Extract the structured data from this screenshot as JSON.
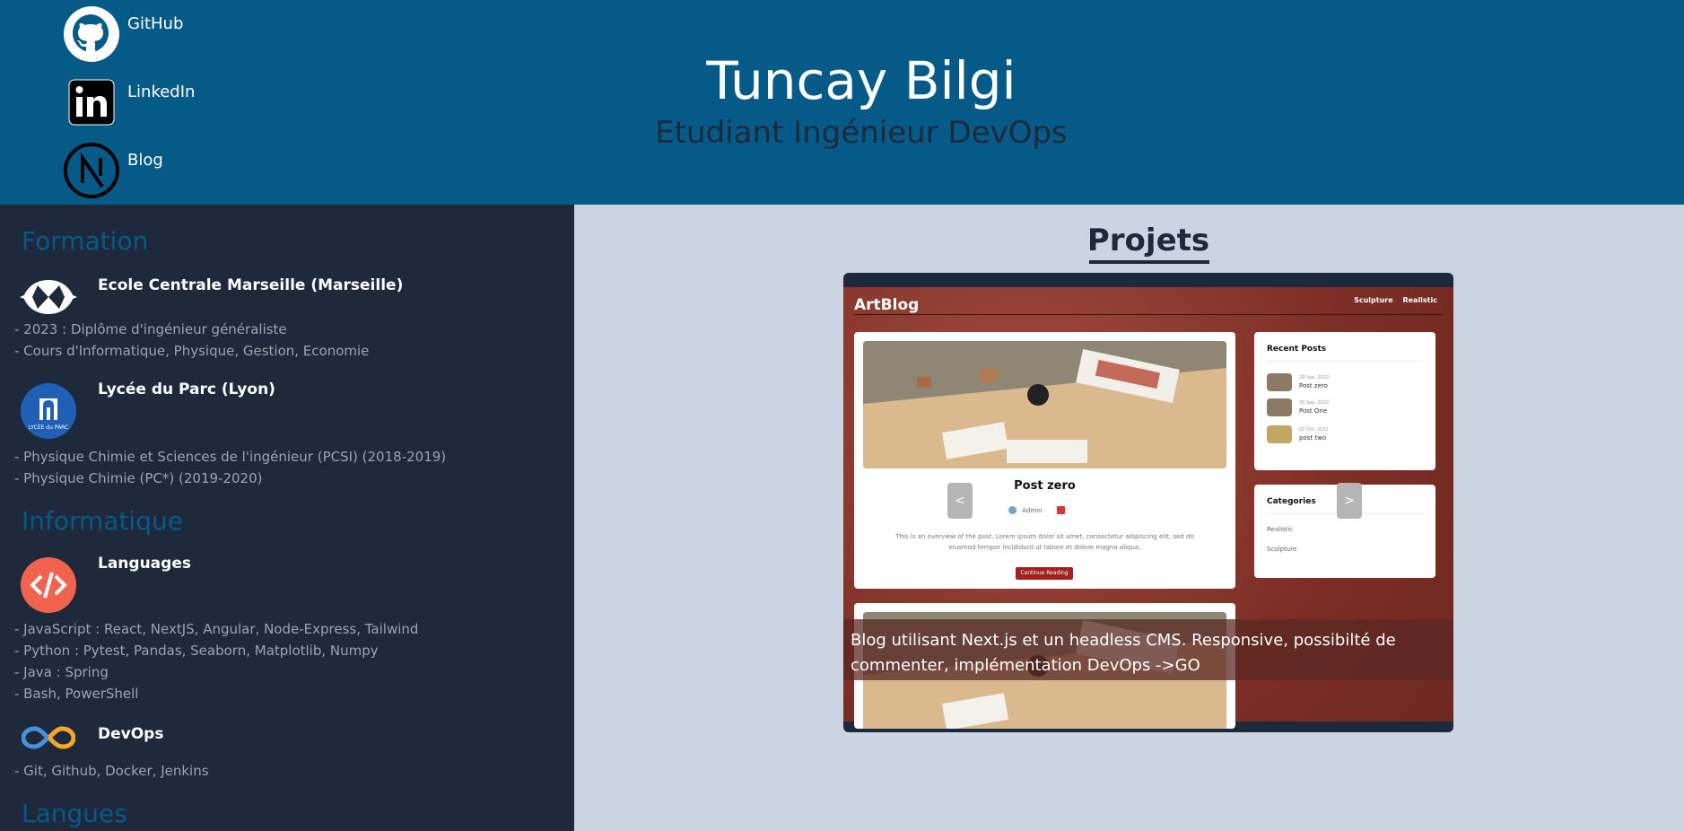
{
  "header": {
    "name": "Tuncay Bilgi",
    "subtitle": "Etudiant Ingénieur DevOps",
    "socials": [
      {
        "label": "GitHub",
        "icon": "github-icon"
      },
      {
        "label": "LinkedIn",
        "icon": "linkedin-icon"
      },
      {
        "label": "Blog",
        "icon": "nextjs-icon"
      }
    ]
  },
  "sidebar": {
    "formation": {
      "title": "Formation",
      "schools": [
        {
          "name": "Ecole Centrale Marseille (Marseille)",
          "icon": "centrale-logo",
          "lines": [
            "- 2023 : Diplôme d'ingénieur généraliste",
            "- Cours d'Informatique, Physique, Gestion, Economie"
          ]
        },
        {
          "name": "Lycée du Parc (Lyon)",
          "icon": "lycee-logo",
          "logo_text": "LYCÉE du PARC",
          "lines": [
            "- Physique Chimie et Sciences de l'ingénieur (PCSI) (2018-2019)",
            "- Physique Chimie (PC*) (2019-2020)"
          ]
        }
      ]
    },
    "informatique": {
      "title": "Informatique",
      "groups": [
        {
          "name": "Languages",
          "icon": "code-icon",
          "lines": [
            "- JavaScript : React, NextJS, Angular, Node-Express, Tailwind",
            "- Python : Pytest, Pandas, Seaborn, Matplotlib, Numpy",
            "- Java : Spring",
            "- Bash, PowerShell"
          ]
        },
        {
          "name": "DevOps",
          "icon": "devops-icon",
          "lines": [
            "- Git, Github, Docker, Jenkins"
          ]
        }
      ]
    },
    "langues": {
      "title": "Langues"
    }
  },
  "projects": {
    "title": "Projets",
    "slide": {
      "caption": "Blog utilisant Next.js et un headless CMS. Responsive, possibilté de commenter, implémentation DevOps ->GO",
      "prev_label": "<",
      "next_label": ">",
      "artblog": {
        "logo": "ArtBlog",
        "nav": [
          "Sculpture",
          "Realistic"
        ],
        "post_title": "Post zero",
        "author": "Admin",
        "excerpt": "This is an overview of the post. Lorem ipsum dolor sit amet, consectetur adipiscing elit, sed do eiusmod tempor incididunt ut labore et dolore magna aliqua.",
        "read_more": "Continue Reading",
        "recent_title": "Recent Posts",
        "recent": [
          {
            "date": "29 Sep, 2022",
            "title": "Post zero"
          },
          {
            "date": "29 Sep, 2022",
            "title": "Post One"
          },
          {
            "date": "02 Oct, 2022",
            "title": "post two"
          }
        ],
        "categories_title": "Categories",
        "categories": [
          "Realistic",
          "Sculpture"
        ]
      }
    }
  },
  "colors": {
    "header_bg": "#065a87",
    "sidebar_bg": "#1e293b",
    "main_bg": "#cbd5e1",
    "section_title": "#065a87"
  }
}
